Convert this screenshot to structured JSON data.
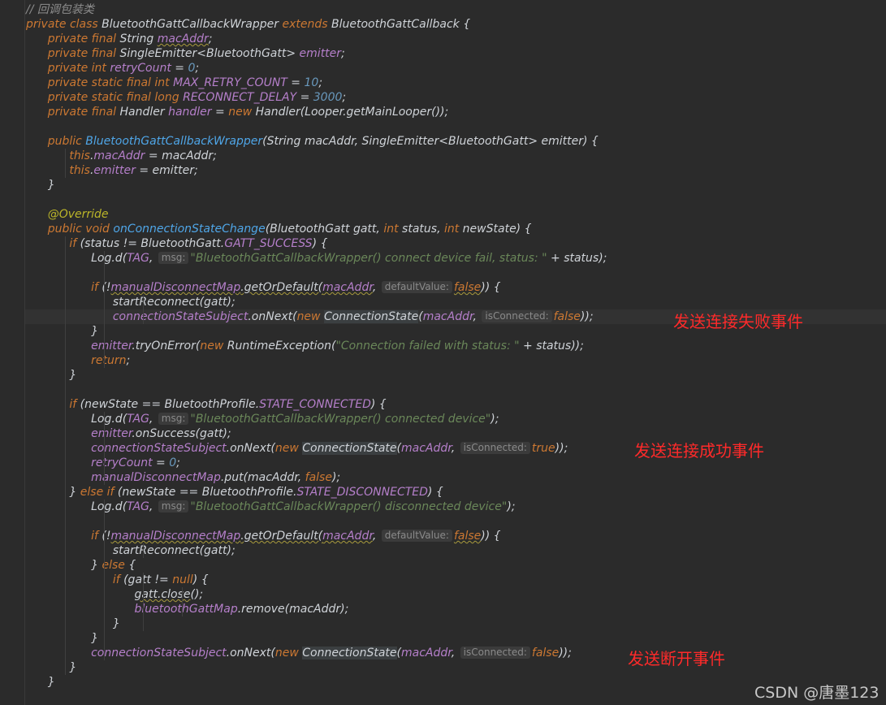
{
  "code": {
    "comment": "// 回调包装类",
    "kw_private": "private",
    "kw_class": "class",
    "kw_extends": "extends",
    "kw_final": "final",
    "kw_static": "static",
    "kw_int": "int",
    "kw_long": "long",
    "kw_new": "new",
    "kw_public": "public",
    "kw_void": "void",
    "kw_if": "if",
    "kw_else": "else",
    "kw_this": "this",
    "kw_return": "return",
    "kw_null": "null",
    "kw_false": "false",
    "kw_true": "true",
    "class_name": "BluetoothGattCallbackWrapper",
    "super_class": "BluetoothGattCallback",
    "t_string": "String",
    "t_emitter": "SingleEmitter<BluetoothGatt>",
    "t_handler": "Handler",
    "f_macAddr": "macAddr",
    "f_emitter": "emitter",
    "f_retryCount": "retryCount",
    "f_max_retry": "MAX_RETRY_COUNT",
    "f_reconnect_delay": "RECONNECT_DELAY",
    "f_handler": "handler",
    "n_zero": "0",
    "n_ten": "10",
    "n_3000": "3000",
    "looper_call": "Handler(Looper.getMainLooper());",
    "ctor_name": "BluetoothGattCallbackWrapper",
    "ctor_params_a": "(String macAddr, SingleEmitter<BluetoothGatt> emitter) {",
    "assign_mac": " = macAddr;",
    "assign_emitter": " = emitter;",
    "annotation": "@Override",
    "method_name": "onConnectionStateChange",
    "method_params_a": "(BluetoothGatt gatt, ",
    "method_params_b": " status, ",
    "method_params_c": " newState) {",
    "cond_status_a": " (status != BluetoothGatt.",
    "gatt_success": "GATT_SUCCESS",
    "cond_close": ") {",
    "log_d": "Log.d(",
    "tag": "TAG",
    "hint_msg": "msg:",
    "str_fail": "\"BluetoothGattCallbackWrapper() connect device fail, status: \"",
    "plus_status_close": " + status);",
    "manual_map": "manualDisconnectMap",
    "get_or_default": ".getOrDefault(",
    "hint_default": "defaultValue:",
    "close_brace_if": ")) {",
    "start_reconnect": "startReconnect(gatt);",
    "subject": "connectionStateSubject",
    "on_next": ".onNext(",
    "conn_state": "ConnectionState",
    "hint_connected": "isConnected:",
    "close_call": "));",
    "brace_close": "}",
    "try_on_error": ".tryOnError(",
    "runtime_ex": "RuntimeException(",
    "str_failed_status": "\"Connection failed with status: \"",
    "plus_status_end": " + status));",
    "cond_newstate_a": " (newState == BluetoothProfile.",
    "state_connected": "STATE_CONNECTED",
    "str_connected": "\"BluetoothGattCallbackWrapper() connected device\"",
    "paren_semi": ");",
    "on_success": ".onSuccess(gatt);",
    "put_call": ".put(macAddr, ",
    "else_if_a": "} ",
    "state_disconnected": "STATE_DISCONNECTED",
    "str_disconnected": "\"BluetoothGattCallbackWrapper() disconnected device\"",
    "else_open": " {",
    "cond_gatt_a": " (gatt != ",
    "gatt_close": "gatt.close",
    "gatt_close_tail": "();",
    "gatt_map": "bluetoothGattMap",
    "remove_call": ".remove(macAddr);"
  },
  "notes": {
    "fail": "发送连接失败事件",
    "success": "发送连接成功事件",
    "disconnect": "发送断开事件"
  },
  "watermark": "CSDN @唐墨123"
}
